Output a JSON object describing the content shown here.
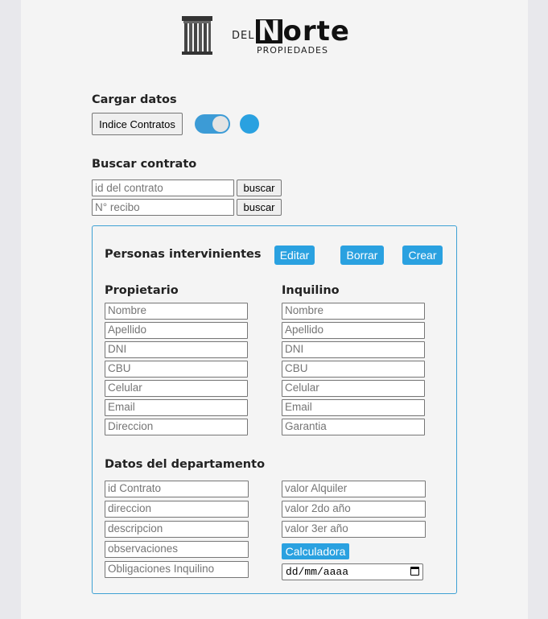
{
  "logo": {
    "del": "DEL",
    "norte_first": "N",
    "norte_rest": "orte",
    "propiedades": "PROPIEDADES"
  },
  "cargar": {
    "title": "Cargar datos",
    "indice_button": "Indice Contratos"
  },
  "buscar": {
    "title": "Buscar contrato",
    "contract_placeholder": "id del contrato",
    "recibo_placeholder": "N° recibo",
    "search_button": "buscar"
  },
  "personas": {
    "title": "Personas intervinientes",
    "edit_button": "Editar",
    "delete_button": "Borrar",
    "create_button": "Crear",
    "propietario": {
      "title": "Propietario",
      "fields": [
        "Nombre",
        "Apellido",
        "DNI",
        "CBU",
        "Celular",
        "Email",
        "Direccion"
      ]
    },
    "inquilino": {
      "title": "Inquilino",
      "fields": [
        "Nombre",
        "Apellido",
        "DNI",
        "CBU",
        "Celular",
        "Email",
        "Garantia"
      ]
    }
  },
  "departamento": {
    "title": "Datos del departamento",
    "left_fields": [
      "id Contrato",
      "direccion",
      "descripcion",
      "observaciones",
      "Obligaciones Inquilino"
    ],
    "right_fields": [
      "valor Alquiler",
      "valor 2do año",
      "valor 3er año"
    ],
    "calc_button": "Calculadora",
    "date_placeholder": "dd/mm/aaaa"
  },
  "colors": {
    "accent": "#2aa1e0",
    "panel_border": "#3ea1d4",
    "background": "#f4f4f4"
  }
}
